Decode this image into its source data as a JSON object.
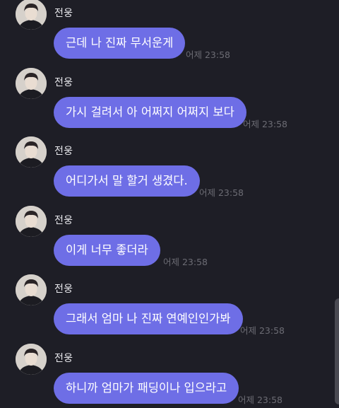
{
  "messages": [
    {
      "sender": "전웅",
      "text": "근데 나 진짜 무서운게",
      "time": "어제 23:58"
    },
    {
      "sender": "전웅",
      "text": "가시 걸려서 아 어쩌지 어쩌지 보다",
      "time": "어제 23:58"
    },
    {
      "sender": "전웅",
      "text": "어디가서 말 할거 생겼다.",
      "time": "어제 23:58"
    },
    {
      "sender": "전웅",
      "text": "이게 너무 좋더라",
      "time": "어제 23:58"
    },
    {
      "sender": "전웅",
      "text": "그래서 엄마 나 진짜 연예인인가봐",
      "time": "어제 23:58"
    },
    {
      "sender": "전웅",
      "text": "하니까 엄마가 패딩이나 입으라고",
      "time": "어제 23:58"
    }
  ],
  "colors": {
    "background": "#1e1e26",
    "bubble": "#6e6ee6",
    "bubble_text": "#ffffff",
    "timestamp": "#6c6c74"
  }
}
